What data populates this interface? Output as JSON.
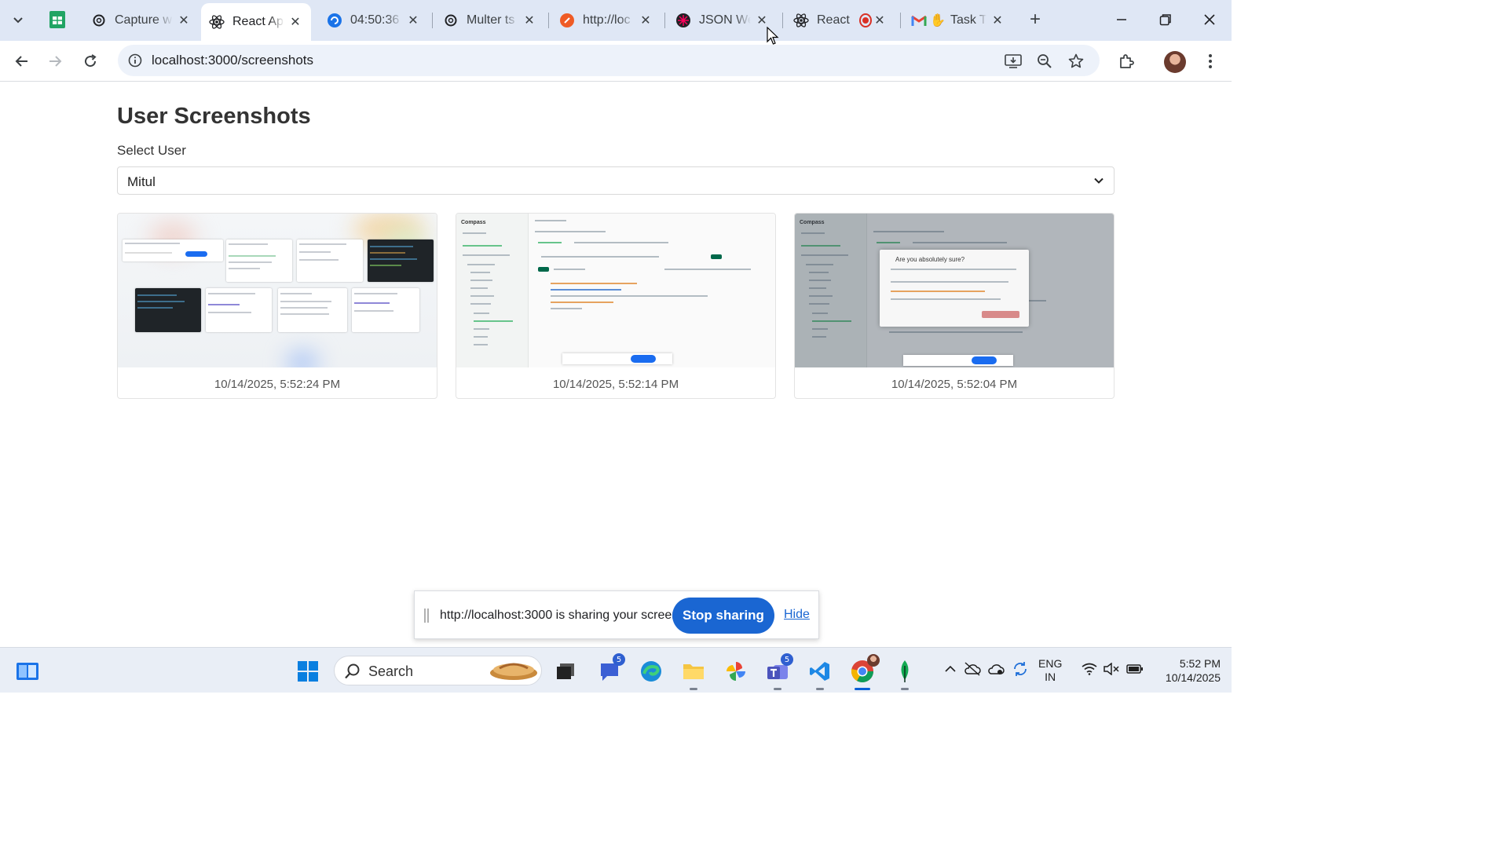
{
  "browser": {
    "tabs": [
      {
        "title": "Capture w",
        "favicon": "openai-icon"
      },
      {
        "title": "React App",
        "favicon": "react-icon",
        "active": true
      },
      {
        "title": "04:50:36 -",
        "favicon": "sync-icon"
      },
      {
        "title": "Multer ts",
        "favicon": "openai-icon"
      },
      {
        "title": "http://loc",
        "favicon": "postman-icon"
      },
      {
        "title": "JSON We",
        "favicon": "json-web-icon"
      },
      {
        "title": "React",
        "favicon": "react-icon",
        "recording": true
      },
      {
        "title": "Task T",
        "favicon": "gmail-icon"
      }
    ],
    "url": "localhost:3000/screenshots"
  },
  "page": {
    "title": "User Screenshots",
    "select_label": "Select User",
    "selected_user": "Mitul",
    "screenshots": [
      {
        "timestamp": "10/14/2025, 5:52:24 PM"
      },
      {
        "timestamp": "10/14/2025, 5:52:14 PM"
      },
      {
        "timestamp": "10/14/2025, 5:52:04 PM"
      }
    ],
    "thumb_texts": {
      "compass_logo": "Compass",
      "modal_title": "Are you absolutely sure?"
    }
  },
  "sharing_bar": {
    "message": "http://localhost:3000 is sharing your screen.",
    "stop_label": "Stop sharing",
    "hide_label": "Hide"
  },
  "taskbar": {
    "search_label": "Search",
    "teams_badge": "5",
    "chat_badge": "5",
    "lang_line1": "ENG",
    "lang_line2": "IN",
    "time": "5:52 PM",
    "date": "10/14/2025"
  },
  "colors": {
    "tabstrip": "#dfe7f5",
    "accent_blue": "#1a66d2",
    "mongodb_green": "#00684a"
  }
}
